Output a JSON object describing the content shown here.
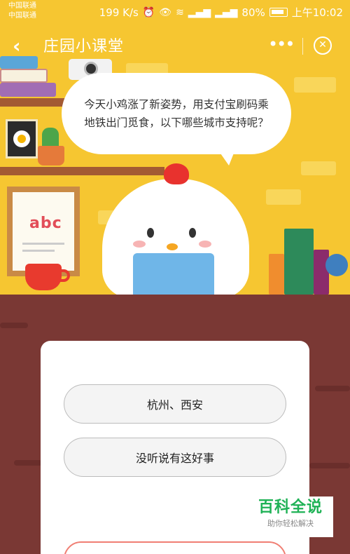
{
  "status_bar": {
    "carrier_1": "中国联通",
    "carrier_2": "中国联通",
    "net_speed": "199 K/s",
    "battery": "80%",
    "time": "上午10:02"
  },
  "header": {
    "back_icon": "chevron-left-icon",
    "title": "庄园小课堂",
    "more_icon": "more-dots-icon",
    "close_icon": "close-circle-icon"
  },
  "scene": {
    "book_letters": "abc"
  },
  "quiz": {
    "question": "今天小鸡涨了新姿势，用支付宝刷码乘地铁出门觅食，以下哪些城市支持呢？",
    "options": [
      "杭州、西安",
      "没听说有这好事"
    ]
  },
  "watermark": {
    "title": "百科全说",
    "subtitle": "助你轻松解决"
  }
}
